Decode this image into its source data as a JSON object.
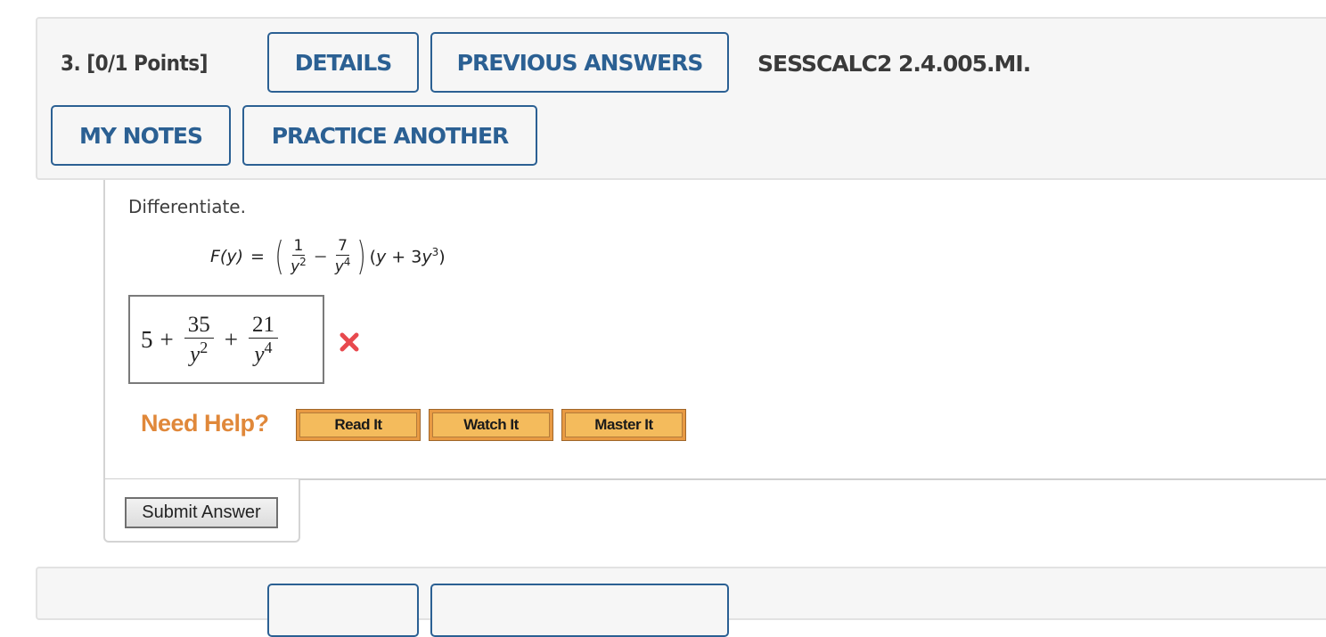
{
  "question": {
    "number_points": "3.  [0/1 Points]",
    "code": "SESSCALC2 2.4.005.MI.",
    "buttons": {
      "details": "DETAILS",
      "previous_answers": "PREVIOUS ANSWERS",
      "my_notes": "MY NOTES",
      "practice_another": "PRACTICE ANOTHER"
    },
    "prompt": "Differentiate.",
    "formula": {
      "lhs": "F(y)",
      "equals": "=",
      "frac1_num": "1",
      "frac1_den_base": "y",
      "frac1_den_exp": "2",
      "minus": "−",
      "frac2_num": "7",
      "frac2_den_base": "y",
      "frac2_den_exp": "4",
      "tail_open": "(",
      "tail_y": "y",
      "tail_plus": " + 3",
      "tail_y2": "y",
      "tail_exp": "3",
      "tail_close": ")"
    },
    "answer": {
      "term1": "5",
      "plus1": "+",
      "frac1_num": "35",
      "frac1_den_base": "y",
      "frac1_den_exp": "2",
      "plus2": "+",
      "frac2_num": "21",
      "frac2_den_base": "y",
      "frac2_den_exp": "4",
      "status": "incorrect",
      "status_icon": "red-x-icon"
    },
    "help": {
      "label": "Need Help?",
      "buttons": [
        "Read It",
        "Watch It",
        "Master It"
      ]
    },
    "submit_label": "Submit Answer"
  },
  "colors": {
    "accent_blue": "#2b6093",
    "help_orange": "#e0883a",
    "help_button": "#f4bb5c",
    "incorrect_red": "#e8494e",
    "header_bg": "#f6f6f6"
  }
}
